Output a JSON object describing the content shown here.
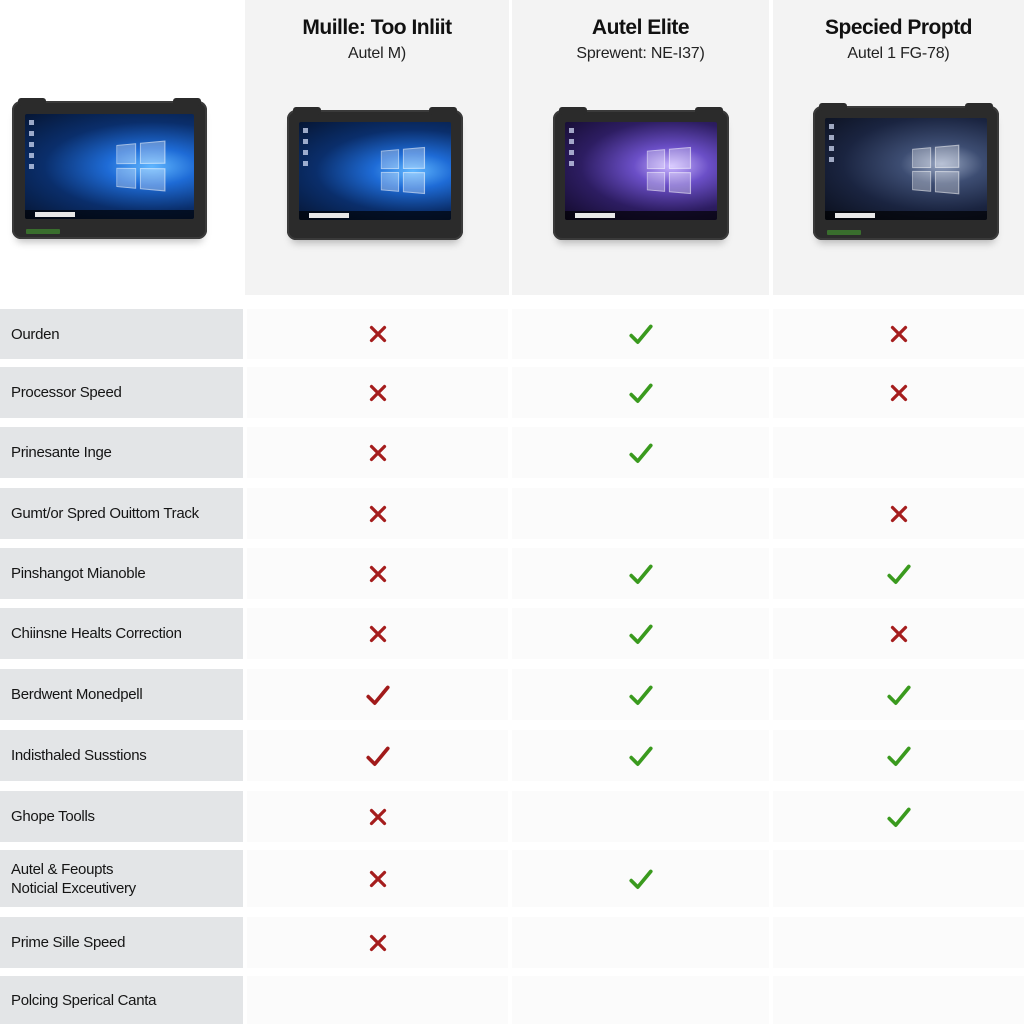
{
  "colors": {
    "check_green": "#3a9a1e",
    "check_red": "#a11a1a",
    "cross_red": "#a51d1d",
    "label_bg": "#e3e5e7",
    "header_bg": "#f3f3f3"
  },
  "products": [
    {
      "title": "Muille: Too Inliit",
      "subtitle": "Autel M)",
      "screen": "blue"
    },
    {
      "title": "Autel Elite",
      "subtitle": "Sprewent: NE-I37)",
      "screen": "purple"
    },
    {
      "title": "Specied Proptd",
      "subtitle": "Autel 1 FG-78)",
      "screen": "dark"
    }
  ],
  "features": [
    {
      "label": "Ourden",
      "values": [
        "cross",
        "check",
        "cross"
      ]
    },
    {
      "label": "Processor Speed",
      "values": [
        "cross",
        "check",
        "cross"
      ]
    },
    {
      "label": "Prinesante Inge",
      "values": [
        "cross",
        "check",
        "none"
      ]
    },
    {
      "label": "Gumt/or Spred Ouittom Track",
      "values": [
        "cross",
        "none",
        "cross"
      ]
    },
    {
      "label": "Pinshangot Mianoble",
      "values": [
        "cross",
        "check",
        "check"
      ]
    },
    {
      "label": "Chiinsne Healts Correction",
      "values": [
        "cross",
        "check",
        "cross"
      ]
    },
    {
      "label": "Berdwent Monedpell",
      "values": [
        "check-red",
        "check",
        "check"
      ]
    },
    {
      "label": "Indisthaled Susstions",
      "values": [
        "check-red",
        "check",
        "check"
      ]
    },
    {
      "label": "Ghope Toolls",
      "values": [
        "cross",
        "none",
        "check"
      ]
    },
    {
      "label": "Autel & Feoupts\nNoticial Exceutivery",
      "values": [
        "cross",
        "check",
        "none"
      ]
    },
    {
      "label": "Prime Sille Speed",
      "values": [
        "cross",
        "none",
        "none"
      ]
    },
    {
      "label": "Polcing Sperical Canta",
      "values": [
        "none",
        "none",
        "none"
      ]
    }
  ]
}
